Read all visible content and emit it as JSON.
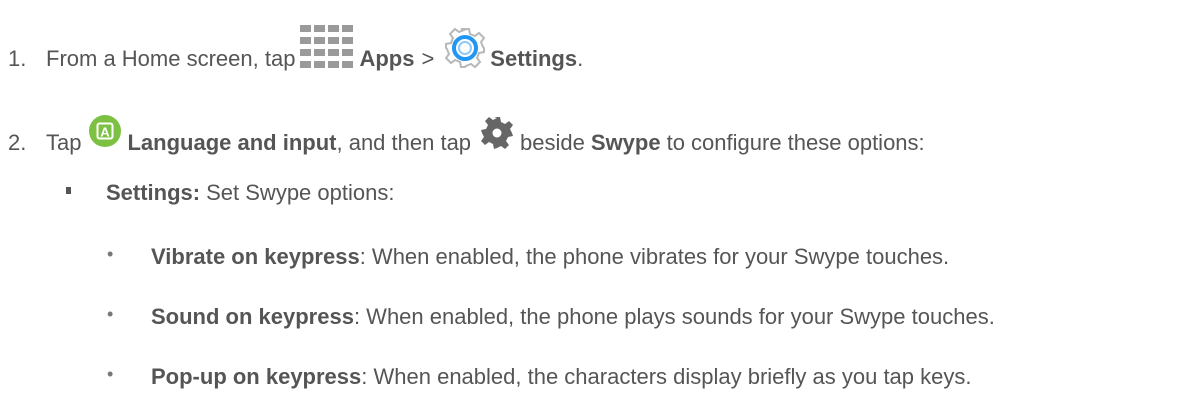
{
  "step1": {
    "number": "1.",
    "text_a": "From a Home screen, tap",
    "apps_icon": "apps-grid-icon",
    "apps_label": "Apps",
    "separator": ">",
    "settings_icon": "settings-gear-icon",
    "settings_label": "Settings",
    "end": "."
  },
  "step2": {
    "number": "2.",
    "text_a": "Tap",
    "lang_icon": "language-input-icon",
    "lang_icon_letter": "A",
    "lang_label": "Language and input",
    "text_b": ", and then tap",
    "gear_icon": "gear-icon",
    "text_c": "beside",
    "swype_label": "Swype",
    "text_d": "to configure these options:"
  },
  "bullet1": {
    "label": "Settings:",
    "text": "Set Swype options:"
  },
  "sub_items": [
    {
      "label": "Vibrate on keypress",
      "text": ": When enabled, the phone vibrates for your Swype touches."
    },
    {
      "label": "Sound on keypress",
      "text": ": When enabled, the phone plays sounds for your Swype touches."
    },
    {
      "label": "Pop-up on keypress",
      "text": ": When enabled, the characters display briefly as you tap keys."
    }
  ],
  "colors": {
    "text": "#555555",
    "apps_icon": "#9a9a9a",
    "settings_icon_ring": "#2196f3",
    "lang_icon_bg": "#7cc142",
    "gear_icon": "#666666"
  }
}
